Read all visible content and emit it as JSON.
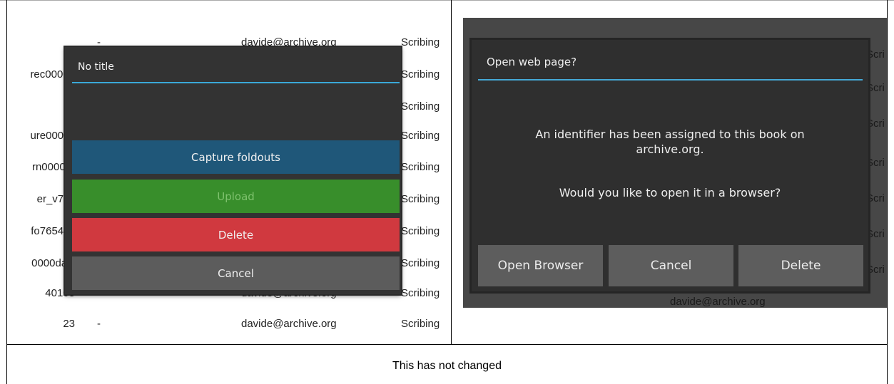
{
  "left_panel": {
    "background_rows": [
      {
        "id": "",
        "dash": "-",
        "email": "davide@archive.org",
        "status": "Scribing"
      },
      {
        "id": "rec0000g",
        "dash": "",
        "email": "",
        "status": "Scribing"
      },
      {
        "id": "",
        "dash": "",
        "email": "",
        "status": "Scribing"
      },
      {
        "id": "ure0000c",
        "dash": "",
        "email": "",
        "status": "Scribing"
      },
      {
        "id": "rn0000ur",
        "dash": "",
        "email": "",
        "status": "Scribing"
      },
      {
        "id": "er_v7x0",
        "dash": "",
        "email": "",
        "status": "Scribing"
      },
      {
        "id": "fo7654ev",
        "dash": "",
        "email": "",
        "status": "Scribing"
      },
      {
        "id": "0000davi",
        "dash": "",
        "email": "",
        "status": "Scribing"
      },
      {
        "id": "40105",
        "dash": "",
        "email": "davide@archive.org",
        "status": "Scribing"
      },
      {
        "id": "23",
        "dash": "-",
        "email": "davide@archive.org",
        "status": "Scribing"
      }
    ],
    "dialog": {
      "title": "No title",
      "buttons": {
        "capture": "Capture foldouts",
        "upload": "Upload",
        "delete": "Delete",
        "cancel": "Cancel"
      }
    }
  },
  "right_panel": {
    "dialog": {
      "title": "Open web page?",
      "message_line1": "An identifier has been assigned to this book on archive.org.",
      "message_line2": "Would you like to open it in a browser?",
      "buttons": {
        "open_browser": "Open Browser",
        "cancel": "Cancel",
        "delete": "Delete"
      }
    },
    "background_email": "davide@archive.org"
  },
  "caption": "This has not changed",
  "colors": {
    "accent_line": "#3aa9d8",
    "capture_button": "#1f5779",
    "upload_button": "#388e2b",
    "delete_button": "#d0393f",
    "cancel_button": "#5c5c5c"
  }
}
